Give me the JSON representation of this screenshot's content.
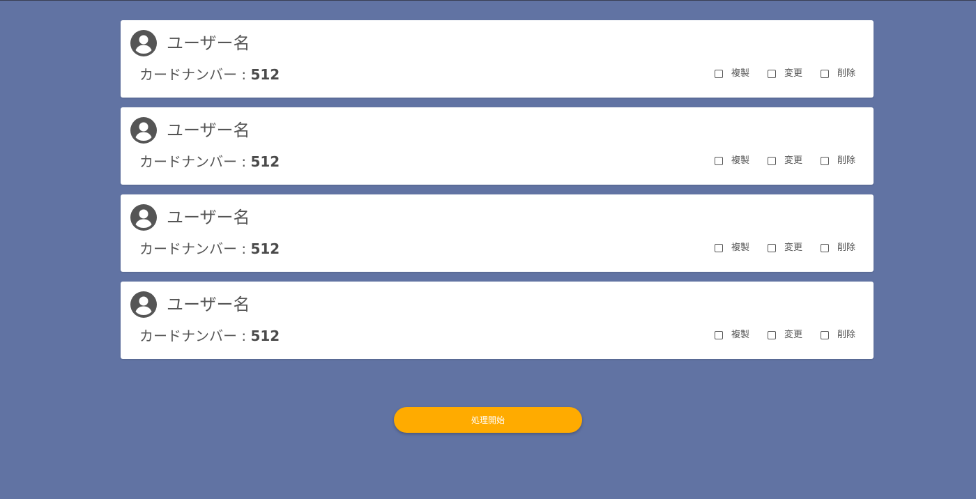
{
  "cards": [
    {
      "username": "ユーザー名",
      "card_number_label": "カードナンバー : ",
      "card_number_value": "512",
      "options": [
        "複製",
        "変更",
        "削除"
      ]
    },
    {
      "username": "ユーザー名",
      "card_number_label": "カードナンバー : ",
      "card_number_value": "512",
      "options": [
        "複製",
        "変更",
        "削除"
      ]
    },
    {
      "username": "ユーザー名",
      "card_number_label": "カードナンバー : ",
      "card_number_value": "512",
      "options": [
        "複製",
        "変更",
        "削除"
      ]
    },
    {
      "username": "ユーザー名",
      "card_number_label": "カードナンバー : ",
      "card_number_value": "512",
      "options": [
        "複製",
        "変更",
        "削除"
      ]
    }
  ],
  "start_button_label": "処理開始",
  "icons": {
    "avatar": "account-circle-icon"
  },
  "colors": {
    "background": "#6173a3",
    "card": "#ffffff",
    "accent_button": "#ffab00",
    "text": "#555555"
  }
}
